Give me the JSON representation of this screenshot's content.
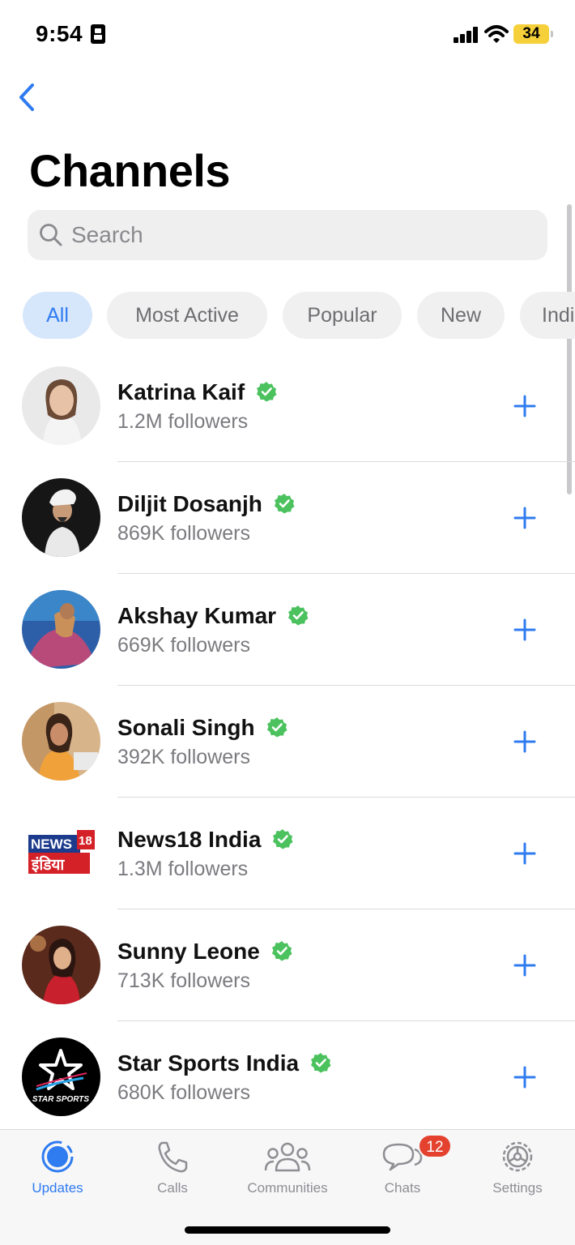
{
  "status_bar": {
    "time": "9:54",
    "battery": "34"
  },
  "header": {
    "title": "Channels",
    "back_icon": "chevron-left-icon"
  },
  "search": {
    "placeholder": "Search",
    "value": ""
  },
  "filters": [
    {
      "label": "All",
      "active": true
    },
    {
      "label": "Most Active",
      "active": false
    },
    {
      "label": "Popular",
      "active": false
    },
    {
      "label": "New",
      "active": false
    },
    {
      "label": "India",
      "active": false
    }
  ],
  "channels": [
    {
      "name": "Katrina Kaif",
      "followers": "1.2M followers",
      "verified": true
    },
    {
      "name": "Diljit Dosanjh",
      "followers": "869K followers",
      "verified": true
    },
    {
      "name": "Akshay Kumar",
      "followers": "669K followers",
      "verified": true
    },
    {
      "name": "Sonali Singh",
      "followers": "392K followers",
      "verified": true
    },
    {
      "name": "News18 India",
      "followers": "1.3M followers",
      "verified": true
    },
    {
      "name": "Sunny Leone",
      "followers": "713K followers",
      "verified": true
    },
    {
      "name": "Star Sports India",
      "followers": "680K followers",
      "verified": true
    }
  ],
  "avatar_logos": {
    "news18_top": "NEWS",
    "news18_badge": "18",
    "news18_hindi": "इंडिया",
    "star_sports": "STAR SPORTS"
  },
  "tabs": [
    {
      "label": "Updates",
      "icon": "updates-icon",
      "active": true
    },
    {
      "label": "Calls",
      "icon": "phone-icon",
      "active": false
    },
    {
      "label": "Communities",
      "icon": "communities-icon",
      "active": false
    },
    {
      "label": "Chats",
      "icon": "chat-bubble-icon",
      "active": false,
      "badge": "12"
    },
    {
      "label": "Settings",
      "icon": "gear-icon",
      "active": false
    }
  ],
  "colors": {
    "accent": "#2f7bf0",
    "verified": "#4cc25f",
    "badge": "#e4422f"
  }
}
